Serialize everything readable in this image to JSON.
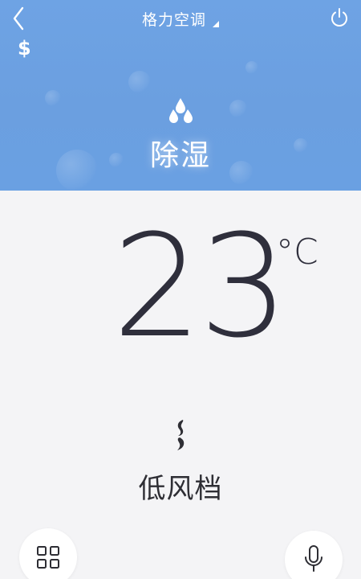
{
  "header": {
    "title": "格力空调",
    "mode": "除湿",
    "cost_symbol": "$",
    "colors": {
      "background": "#6ba0e1",
      "text": "#ffffff"
    }
  },
  "temperature": {
    "value": "23",
    "unit": "°C"
  },
  "fan": {
    "label": "低风档"
  },
  "icons": {
    "back": "chevron-left-icon",
    "power": "power-icon",
    "mode": "water-drops-icon",
    "fan": "fan-speed-icon",
    "menu": "grid-icon",
    "voice": "microphone-icon"
  }
}
